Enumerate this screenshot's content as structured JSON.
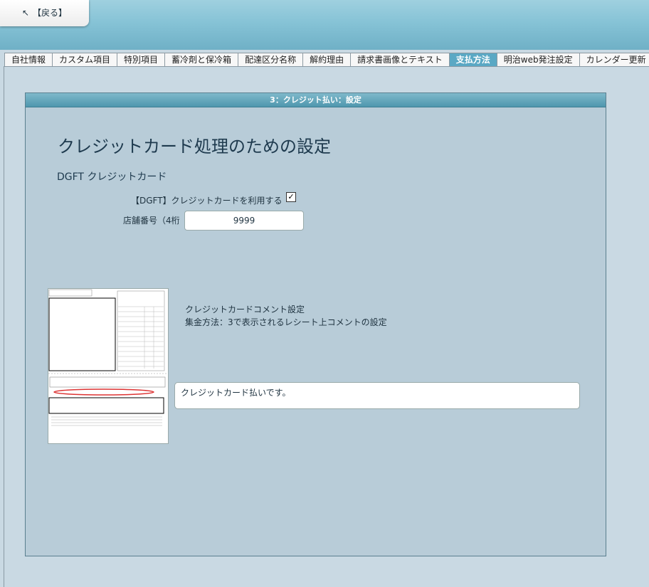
{
  "header": {
    "back_label": "【戻る】",
    "back_icon": "↖"
  },
  "tabs": [
    {
      "label": "自社情報",
      "active": false
    },
    {
      "label": "カスタム項目",
      "active": false
    },
    {
      "label": "特別項目",
      "active": false
    },
    {
      "label": "蓄冷剤と保冷箱",
      "active": false
    },
    {
      "label": "配達区分名称",
      "active": false
    },
    {
      "label": "解約理由",
      "active": false
    },
    {
      "label": "請求書画像とテキスト",
      "active": false
    },
    {
      "label": "支払方法",
      "active": true
    },
    {
      "label": "明治web発注設定",
      "active": false
    },
    {
      "label": "カレンダー更新",
      "active": false
    }
  ],
  "panel": {
    "header": "3：クレジット払い：設定",
    "title": "クレジットカード処理のための設定",
    "subtitle": "DGFT クレジットカード",
    "use_cc_label": "【DGFT】クレジットカードを利用する",
    "use_cc_checked": true,
    "check_glyph": "✓",
    "shop_label": "店舗番号（4桁",
    "shop_value": "9999",
    "comment_title": "クレジットカードコメント設定",
    "comment_sub": "集金方法：3で表示されるレシート上コメントの設定",
    "comment_value": "クレジットカード払いです。"
  },
  "colors": {
    "accent": "#5aa8c4",
    "panel_bg": "#b8ccd8",
    "page_bg": "#c9d9e3"
  }
}
